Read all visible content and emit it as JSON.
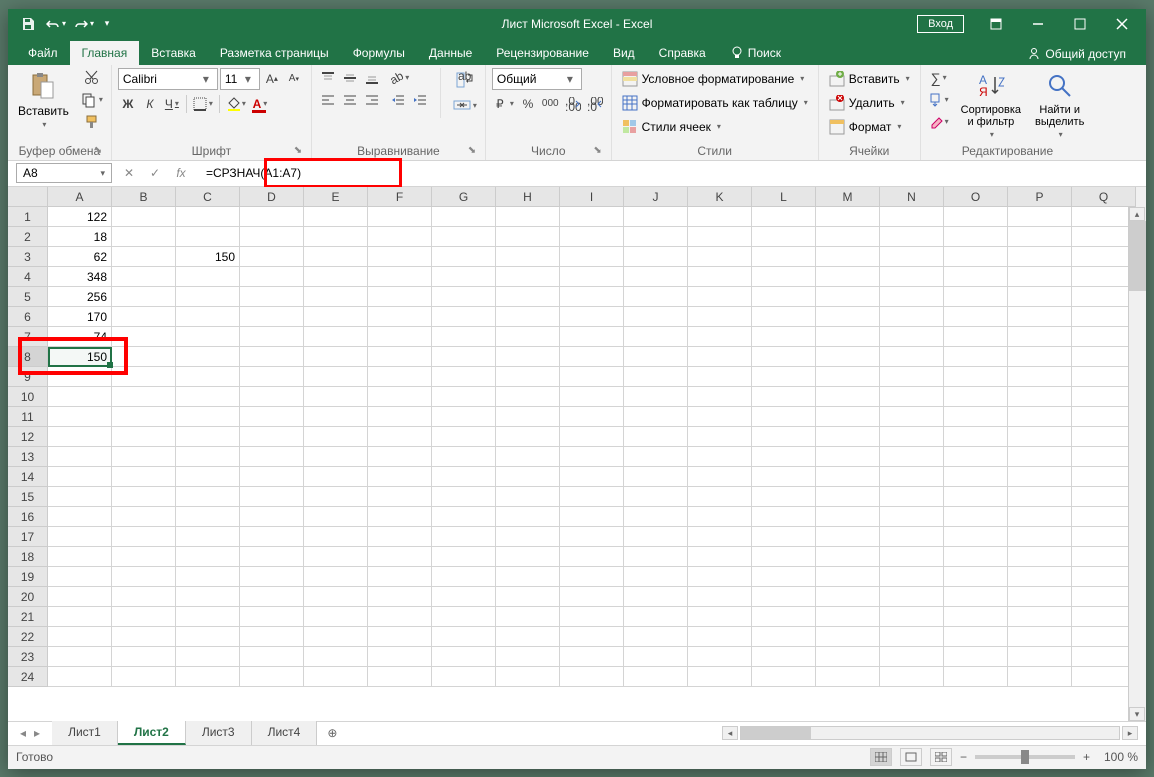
{
  "title": "Лист Microsoft Excel - Excel",
  "signin": "Вход",
  "tabs": [
    "Файл",
    "Главная",
    "Вставка",
    "Разметка страницы",
    "Формулы",
    "Данные",
    "Рецензирование",
    "Вид",
    "Справка"
  ],
  "active_tab": 1,
  "search_hint": "Поиск",
  "share": "Общий доступ",
  "ribbon": {
    "clipboard": {
      "label": "Буфер обмена",
      "paste": "Вставить"
    },
    "font": {
      "label": "Шрифт",
      "name": "Calibri",
      "size": "11",
      "bold": "Ж",
      "italic": "К",
      "underline": "Ч"
    },
    "alignment": {
      "label": "Выравнивание"
    },
    "number": {
      "label": "Число",
      "format": "Общий"
    },
    "styles": {
      "label": "Стили",
      "conditional": "Условное форматирование",
      "table": "Форматировать как таблицу",
      "cell": "Стили ячеек"
    },
    "cells": {
      "label": "Ячейки",
      "insert": "Вставить",
      "delete": "Удалить",
      "format": "Формат"
    },
    "editing": {
      "label": "Редактирование",
      "sort": "Сортировка\nи фильтр",
      "find": "Найти и\nвыделить"
    }
  },
  "namebox": "A8",
  "formula": "=СРЗНАЧ(A1:A7)",
  "columns": [
    "A",
    "B",
    "C",
    "D",
    "E",
    "F",
    "G",
    "H",
    "I",
    "J",
    "K",
    "L",
    "M",
    "N",
    "O",
    "P",
    "Q"
  ],
  "row_labels": [
    "1",
    "2",
    "3",
    "4",
    "5",
    "6",
    "7",
    "8",
    "9",
    "10",
    "11",
    "12",
    "13",
    "14",
    "15",
    "16",
    "17",
    "18",
    "19",
    "20",
    "21",
    "22",
    "23",
    "24"
  ],
  "cells": {
    "A1": "122",
    "A2": "18",
    "A3": "62",
    "A4": "348",
    "A5": "256",
    "A6": "170",
    "A7": "74",
    "A8": "150",
    "C3": "150"
  },
  "selected_cell": "A8",
  "sheets": [
    "Лист1",
    "Лист2",
    "Лист3",
    "Лист4"
  ],
  "active_sheet": 1,
  "status": "Готово",
  "zoom": "100 %"
}
